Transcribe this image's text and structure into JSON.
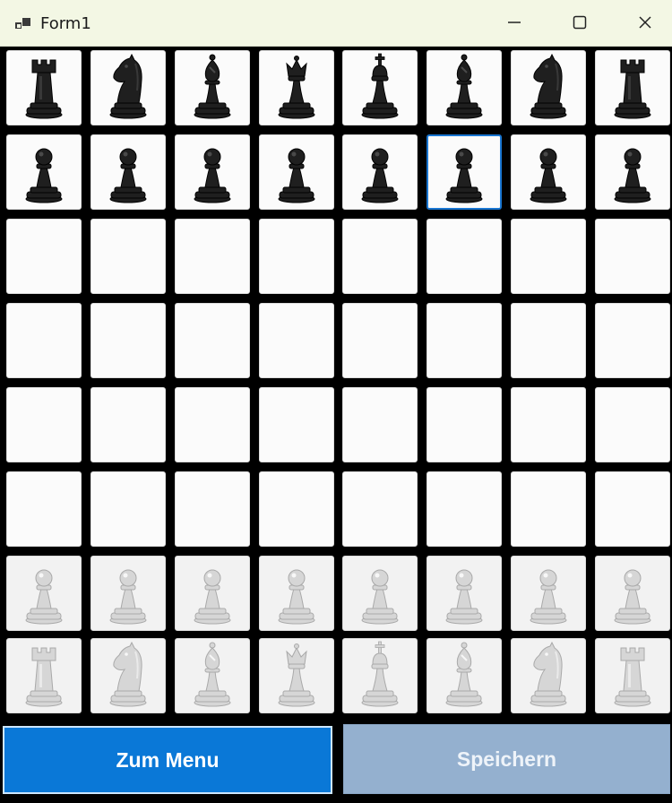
{
  "window": {
    "title": "Form1",
    "controls": {
      "minimize": "minimize-icon",
      "maximize": "maximize-icon",
      "close": "close-icon"
    }
  },
  "board": {
    "rows": [
      [
        "black-rook",
        "black-knight",
        "black-bishop",
        "black-queen",
        "black-king",
        "black-bishop",
        "black-knight",
        "black-rook"
      ],
      [
        "black-pawn",
        "black-pawn",
        "black-pawn",
        "black-pawn",
        "black-pawn",
        "black-pawn",
        "black-pawn",
        "black-pawn"
      ],
      [
        "",
        "",
        "",
        "",
        "",
        "",
        "",
        ""
      ],
      [
        "",
        "",
        "",
        "",
        "",
        "",
        "",
        ""
      ],
      [
        "",
        "",
        "",
        "",
        "",
        "",
        "",
        ""
      ],
      [
        "",
        "",
        "",
        "",
        "",
        "",
        "",
        ""
      ],
      [
        "white-pawn",
        "white-pawn",
        "white-pawn",
        "white-pawn",
        "white-pawn",
        "white-pawn",
        "white-pawn",
        "white-pawn"
      ],
      [
        "white-rook",
        "white-knight",
        "white-bishop",
        "white-queen",
        "white-king",
        "white-bishop",
        "white-knight",
        "white-rook"
      ]
    ],
    "selected": {
      "row": 1,
      "col": 5
    }
  },
  "buttons": {
    "menu_label": "Zum Menu",
    "save_label": "Speichern"
  },
  "colors": {
    "titlebar": "#f3f7e4",
    "menu_button": "#0a78d7",
    "save_button": "#94b0cf",
    "selection": "#1976d2",
    "black_piece": "#1f1f1f",
    "white_piece": "#d6d6d6"
  }
}
